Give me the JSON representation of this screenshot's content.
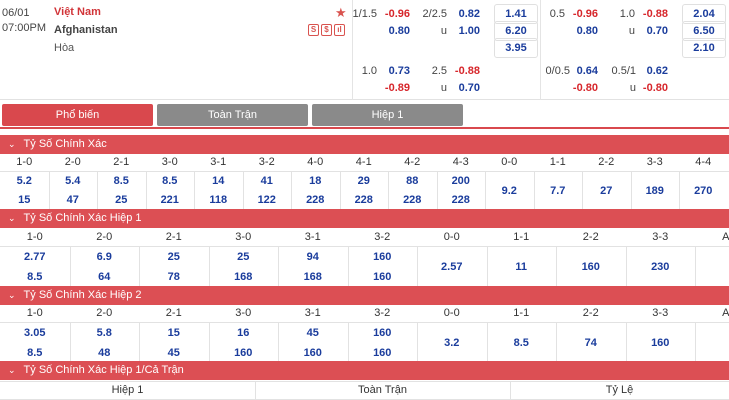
{
  "match": {
    "date": "06/01",
    "time": "07:00PM",
    "home": "Việt Nam",
    "away": "Afghanistan",
    "draw": "Hòa",
    "icons": [
      "S",
      "$",
      "ıl"
    ]
  },
  "odds": {
    "ft_hdp1": {
      "line": "1/1.5",
      "home": "-0.96",
      "away": "0.80"
    },
    "ft_ou1": {
      "line": "2/2.5",
      "home": "0.82",
      "u": "u",
      "away": "1.00"
    },
    "ft_1x2": [
      "1.41",
      "6.20",
      "3.95"
    ],
    "ht_hdp1": {
      "line": "0.5",
      "home": "-0.96",
      "away": "0.80"
    },
    "ht_ou1": {
      "line": "1.0",
      "home": "-0.88",
      "u": "u",
      "away": "0.70"
    },
    "ht_1x2": [
      "2.04",
      "6.50",
      "2.10"
    ],
    "ft_hdp2": {
      "line": "1.0",
      "home": "0.73",
      "away": "-0.89"
    },
    "ft_ou2": {
      "line": "2.5",
      "home": "-0.88",
      "u": "u",
      "away": "0.70"
    },
    "ht_hdp2": {
      "line": "0/0.5",
      "home": "0.64",
      "away": "-0.80"
    },
    "ht_ou2": {
      "line": "0.5/1",
      "home": "0.62",
      "u": "u",
      "away": "-0.80"
    }
  },
  "tabs": [
    "Phổ biến",
    "Toàn Trận",
    "Hiệp 1"
  ],
  "sections": {
    "s1": "Tỷ Số Chính Xác",
    "s2": "Tỷ Số Chính Xác Hiệp 1",
    "s3": "Tỷ Số Chính Xác Hiệp 2",
    "s4": "Tỷ Số Chính Xác Hiệp 1/Cả Trận"
  },
  "cs_full": {
    "headers": [
      "1-0",
      "2-0",
      "2-1",
      "3-0",
      "3-1",
      "3-2",
      "4-0",
      "4-1",
      "4-2",
      "4-3",
      "0-0",
      "1-1",
      "2-2",
      "3-3",
      "4-4"
    ],
    "home": [
      "5.2",
      "5.4",
      "8.5",
      "8.5",
      "14",
      "41",
      "18",
      "29",
      "88",
      "200"
    ],
    "away": [
      "15",
      "47",
      "25",
      "221",
      "118",
      "122",
      "228",
      "228",
      "228",
      "228"
    ],
    "draw": [
      "9.2",
      "7.7",
      "27",
      "189",
      "270"
    ]
  },
  "cs_h1": {
    "headers": [
      "1-0",
      "2-0",
      "2-1",
      "3-0",
      "3-1",
      "3-2",
      "0-0",
      "1-1",
      "2-2",
      "3-3",
      "AC"
    ],
    "home": [
      "2.77",
      "6.9",
      "25",
      "25",
      "94",
      "160"
    ],
    "away": [
      "8.5",
      "64",
      "78",
      "168",
      "168",
      "160"
    ],
    "draw": [
      "2.57",
      "11",
      "160",
      "230"
    ]
  },
  "cs_h2": {
    "headers": [
      "1-0",
      "2-0",
      "2-1",
      "3-0",
      "3-1",
      "3-2",
      "0-0",
      "1-1",
      "2-2",
      "3-3",
      "AC"
    ],
    "home": [
      "3.05",
      "5.8",
      "15",
      "16",
      "45",
      "160"
    ],
    "away": [
      "8.5",
      "48",
      "45",
      "160",
      "160",
      "160"
    ],
    "draw": [
      "3.2",
      "8.5",
      "74",
      "160"
    ]
  },
  "htft": {
    "headers": [
      "Hiệp 1",
      "Toàn Trận",
      "Tỷ Lệ"
    ]
  }
}
